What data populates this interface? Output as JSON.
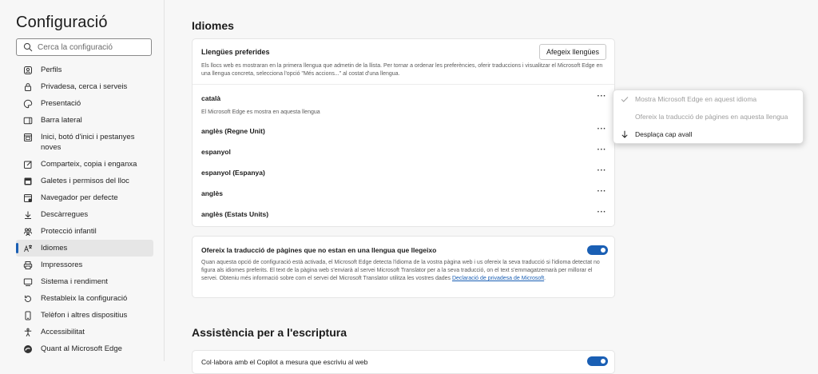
{
  "sidebar": {
    "title": "Configuració",
    "search_placeholder": "Cerca la configuració",
    "items": [
      {
        "label": "Perfils"
      },
      {
        "label": "Privadesa, cerca i serveis"
      },
      {
        "label": "Presentació"
      },
      {
        "label": "Barra lateral"
      },
      {
        "label": "Inici, botó d'inici i pestanyes noves"
      },
      {
        "label": "Comparteix, copia i enganxa"
      },
      {
        "label": "Galetes i permisos del lloc"
      },
      {
        "label": "Navegador per defecte"
      },
      {
        "label": "Descàrregues"
      },
      {
        "label": "Protecció infantil"
      },
      {
        "label": "Idiomes"
      },
      {
        "label": "Impressores"
      },
      {
        "label": "Sistema i rendiment"
      },
      {
        "label": "Restableix la configuració"
      },
      {
        "label": "Telèfon i altres dispositius"
      },
      {
        "label": "Accessibilitat"
      },
      {
        "label": "Quant al Microsoft Edge"
      }
    ]
  },
  "main": {
    "languages_title": "Idiomes",
    "preferred": {
      "heading": "Llengües preferides",
      "add_button": "Afegeix llengües",
      "description": "Els llocs web es mostraran en la primera llengua que admetin de la llista. Per tornar a ordenar les preferències, oferir traduccions i visualitzar el Microsoft Edge en una llengua concreta, selecciona l'opció \"Més accions...\" al costat d'una llengua.",
      "languages": [
        {
          "name": "català",
          "sub": "El Microsoft Edge es mostra en aquesta llengua"
        },
        {
          "name": "anglès (Regne Unit)"
        },
        {
          "name": "espanyol"
        },
        {
          "name": "espanyol (Espanya)"
        },
        {
          "name": "anglès"
        },
        {
          "name": "anglès (Estats Units)"
        }
      ],
      "more_label": "···"
    },
    "translate": {
      "heading": "Ofereix la traducció de pàgines que no estan en una llengua que llegeixo",
      "toggle_on": true,
      "description": "Quan aquesta opció de configuració està activada, el Microsoft Edge detecta l'idioma de la vostra pàgina web i us ofereix la seva traducció si l'idioma detectat no figura als idiomes preferits. El text de la pàgina web s'enviarà al servei Microsoft Translator per a la seva traducció, on el text s'emmagatzemarà per millorar el servei. Obteniu més informació sobre com el servei del Microsoft Translator utilitza les vostres dades ",
      "link": "Declaració de privadesa de Microsoft",
      "link_suffix": "."
    },
    "writing_title": "Assistència per a l'escriptura",
    "writing_row": "Col·labora amb el Copilot a mesura que escriviu al web"
  },
  "menu": {
    "items": [
      {
        "label": "Mostra Microsoft Edge en aquest idioma",
        "enabled": false
      },
      {
        "label": "Ofereix la traducció de pàgines en aquesta llengua",
        "enabled": false
      },
      {
        "label": "Desplaça cap avall",
        "enabled": true
      }
    ]
  },
  "colors": {
    "accent": "#1a5fb4",
    "background": "#f7f7f7",
    "card": "#ffffff"
  }
}
